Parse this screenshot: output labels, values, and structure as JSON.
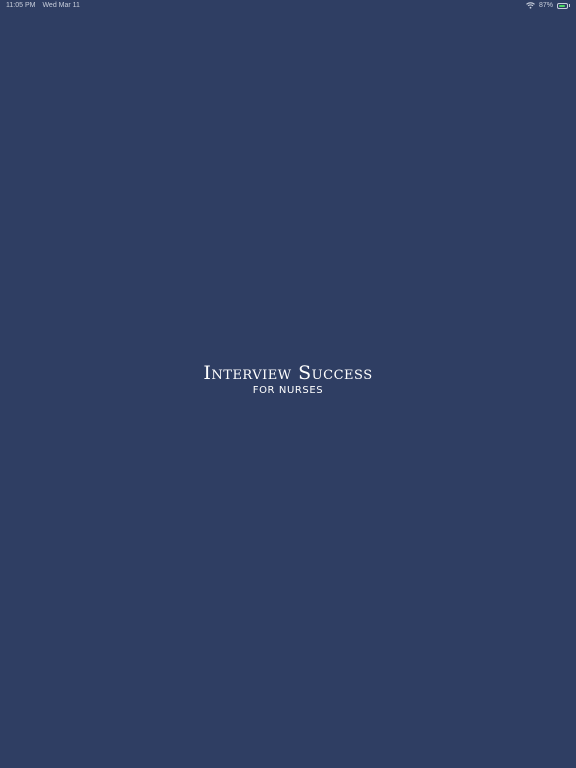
{
  "status_bar": {
    "time": "11:05 PM",
    "date": "Wed Mar 11",
    "battery_percent_label": "87%",
    "battery_level": 0.87,
    "wifi_icon": "wifi-icon",
    "battery_icon": "battery-icon"
  },
  "splash": {
    "title": "Interview Success",
    "subtitle": "FOR NURSES"
  },
  "colors": {
    "background": "#2f3e63",
    "text": "#ffffff",
    "battery_fill": "#4cd964"
  }
}
